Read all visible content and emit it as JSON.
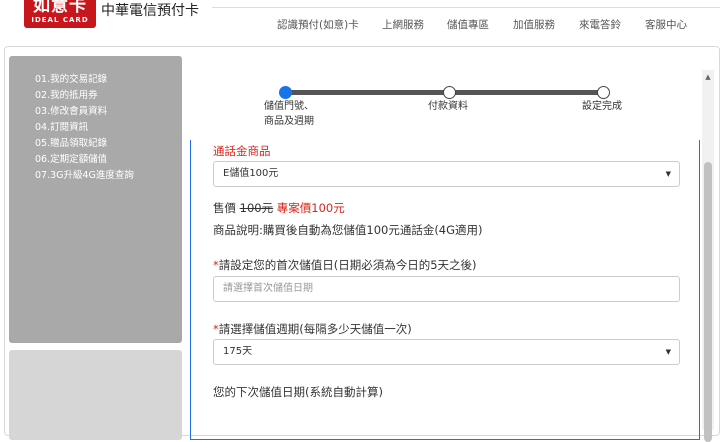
{
  "header": {
    "logo_main": "如意卡",
    "logo_sub": "IDEAL CARD",
    "brand": "中華電信預付卡",
    "nav": [
      "認識預付(如意)卡",
      "上網服務",
      "儲值專區",
      "加值服務",
      "來電答鈴",
      "客服中心"
    ]
  },
  "sidebar": {
    "items": [
      "01.我的交易記錄",
      "02.我的抵用券",
      "03.修改會員資料",
      "04.訂閱資訊",
      "05.贈品領取紀錄",
      "06.定期定額儲值",
      "07.3G升級4G進度查詢"
    ]
  },
  "progress": {
    "steps": [
      "儲值門號、",
      "商品及週期",
      "付款資料",
      "設定完成"
    ],
    "active_index": 0
  },
  "form": {
    "product_label": "通話金商品",
    "product_value": "E儲值100元",
    "price_prefix": "售價",
    "original_price": "100元",
    "special_price": "專案價100元",
    "description": "商品說明:購買後自動為您儲值100元通話金(4G適用)",
    "required_mark": "*",
    "first_date_label": "請設定您的首次儲值日(日期必須為今日的5天之後)",
    "first_date_placeholder": "請選擇首次儲值日期",
    "cycle_label": "請選擇儲值週期(每隔多少天儲值一次)",
    "cycle_value": "175天",
    "next_date_label": "您的下次儲值日期(系統自動計算)"
  },
  "icons": {
    "caret": "▼",
    "scroll_up": "▲"
  },
  "colors": {
    "brand_red": "#c8161d",
    "accent_blue": "#1a73e8",
    "price_red": "#d9261c"
  }
}
